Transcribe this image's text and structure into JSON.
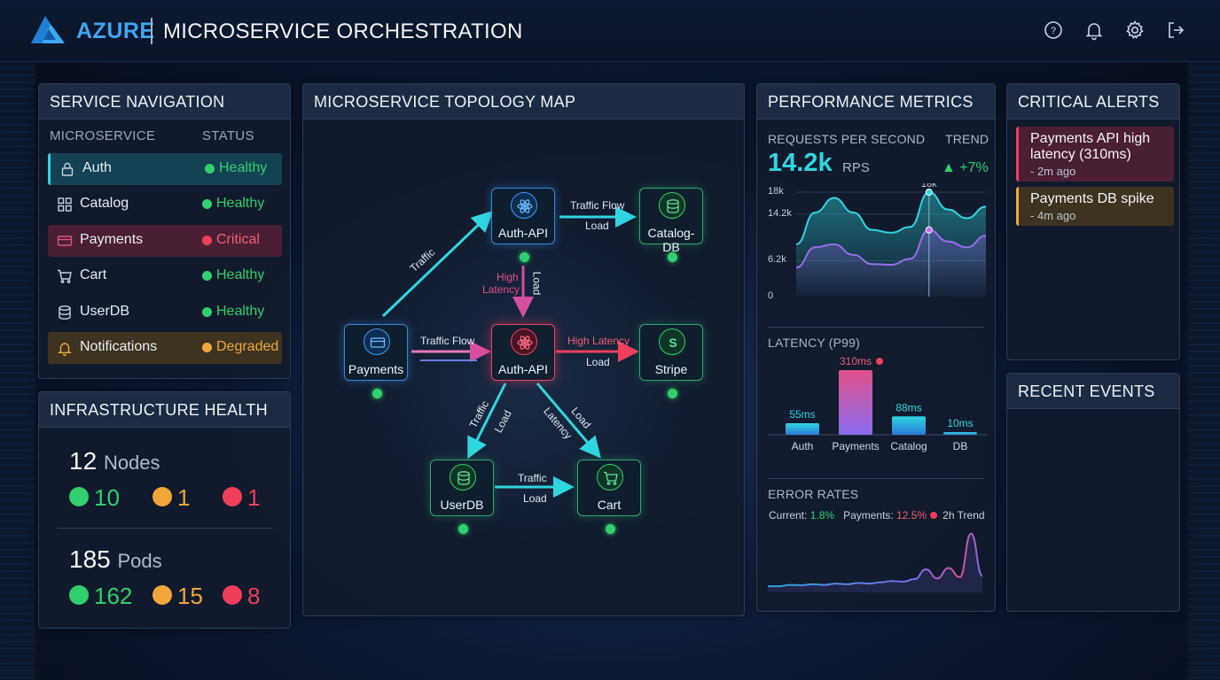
{
  "header": {
    "brand": "AZURE",
    "title": "MICROSERVICE ORCHESTRATION",
    "help_badge": "?"
  },
  "nav": {
    "title": "SERVICE NAVIGATION",
    "col_service": "MICROSERVICE",
    "col_status": "STATUS",
    "items": [
      {
        "label": "Auth",
        "status": "Healthy",
        "icon": "lock-icon"
      },
      {
        "label": "Catalog",
        "status": "Healthy",
        "icon": "grid-icon"
      },
      {
        "label": "Payments",
        "status": "Critical",
        "icon": "credit-card-icon"
      },
      {
        "label": "Cart",
        "status": "Healthy",
        "icon": "cart-icon"
      },
      {
        "label": "UserDB",
        "status": "Healthy",
        "icon": "database-icon"
      },
      {
        "label": "Notifications",
        "status": "Degraded",
        "icon": "bell-icon"
      }
    ]
  },
  "infra": {
    "title": "INFRASTRUCTURE HEALTH",
    "nodes_count": "12",
    "nodes_label": "Nodes",
    "nodes": {
      "healthy": "10",
      "warning": "1",
      "critical": "1"
    },
    "pods_count": "185",
    "pods_label": "Pods",
    "pods": {
      "healthy": "162",
      "warning": "15",
      "critical": "8"
    }
  },
  "topology": {
    "title": "MICROSERVICE TOPOLOGY MAP",
    "nodes": {
      "auth_top": "Auth-API",
      "catalog_db": "Catalog-DB",
      "payments": "Payments",
      "auth_center": "Auth-API",
      "stripe": "Stripe",
      "userdb": "UserDB",
      "cart": "Cart"
    },
    "edges": {
      "pay_auth_top": "Traffic",
      "auth_catalog_a": "Traffic Flow",
      "auth_catalog_b": "Load",
      "auth_top_center_a": "High",
      "auth_top_center_b": "Latency",
      "auth_top_center_c": "Load",
      "pay_auth_center": "Traffic Flow",
      "auth_stripe_a": "High Latency",
      "auth_stripe_b": "Load",
      "auth_userdb_a": "Traffic",
      "auth_userdb_b": "Load",
      "auth_cart_a": "Latency",
      "auth_cart_b": "Load",
      "userdb_cart_a": "Traffic",
      "userdb_cart_b": "Load"
    }
  },
  "metrics": {
    "title": "PERFORMANCE METRICS",
    "rps_label": "REQUESTS PER SECOND",
    "trend_label": "TREND",
    "rps_value": "14.2k",
    "rps_unit": "RPS",
    "trend_value": "+7%",
    "latency_title": "LATENCY (P99)",
    "error_title": "ERROR RATES",
    "error_current_label": "Current:",
    "error_current": "1.8%",
    "error_payments_label": "Payments:",
    "error_payments": "12.5%",
    "error_trend_label": "2h Trend"
  },
  "chart_data": [
    {
      "type": "area",
      "title": "REQUESTS PER SECOND",
      "y_ticks": [
        "18k",
        "14.2k",
        "6.2k",
        "0"
      ],
      "ylim": [
        0,
        18000
      ],
      "annotation": "18k",
      "series": [
        {
          "values": [
            9000,
            14500,
            17000,
            14500,
            11500,
            11000,
            12000,
            18000,
            15000,
            13500,
            15500
          ]
        },
        {
          "values": [
            5000,
            8500,
            9000,
            7200,
            5600,
            5500,
            6500,
            11500,
            9500,
            8500,
            10500
          ]
        }
      ],
      "colors": [
        "#2fd6e0",
        "#9a6cf0"
      ]
    },
    {
      "type": "bar",
      "title": "LATENCY (P99)",
      "categories": [
        "Auth",
        "Payments",
        "Catalog",
        "DB"
      ],
      "values": [
        55,
        310,
        88,
        10
      ],
      "value_labels": [
        "55ms",
        "310ms",
        "88ms",
        "10ms"
      ],
      "ylim": [
        0,
        340
      ]
    },
    {
      "type": "line",
      "title": "ERROR RATES",
      "values": [
        0.4,
        0.4,
        0.6,
        0.55,
        0.7,
        0.6,
        0.8,
        0.7,
        0.9,
        0.8,
        1.0,
        1.2,
        1.1,
        1.5,
        3.0,
        1.6,
        3.2,
        1.8,
        8.5,
        2.0
      ],
      "ylim": [
        0,
        9
      ]
    }
  ],
  "alerts": {
    "title": "CRITICAL ALERTS",
    "items": [
      {
        "text": "Payments API high latency (310ms)",
        "time": "- 2m ago"
      },
      {
        "text": "Payments DB spike",
        "time": "- 4m ago"
      }
    ]
  },
  "events": {
    "title": "RECENT EVENTS"
  },
  "colors": {
    "healthy": "#31cf6d",
    "warning": "#f0a63a",
    "critical": "#ef3f5c",
    "accent": "#2fd6e0"
  }
}
